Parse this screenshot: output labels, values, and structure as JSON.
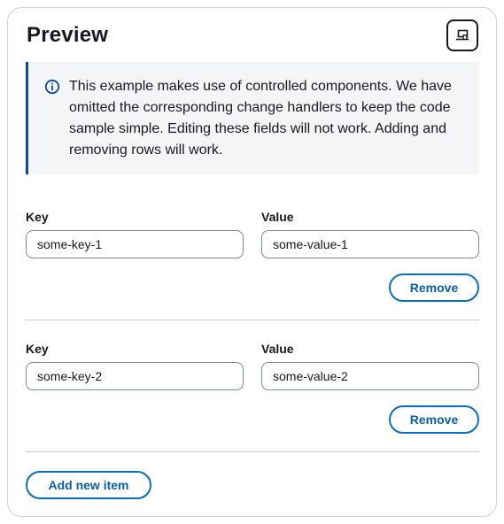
{
  "panel": {
    "title": "Preview",
    "header_icon": "open-in-window-icon"
  },
  "info": {
    "icon": "info-icon",
    "text": "This example makes use of controlled components. We have omitted the corresponding change handlers to keep the code sample simple. Editing these fields will not work. Adding and removing rows will work."
  },
  "rows": [
    {
      "key_label": "Key",
      "key_value": "some-key-1",
      "value_label": "Value",
      "value_value": "some-value-1",
      "remove_label": "Remove"
    },
    {
      "key_label": "Key",
      "key_value": "some-key-2",
      "value_label": "Value",
      "value_value": "some-value-2",
      "remove_label": "Remove"
    }
  ],
  "add_button_label": "Add new item",
  "colors": {
    "accent": "#0b6ec5",
    "info_border": "#0b4a8f",
    "info_background": "#f4f5f7"
  }
}
